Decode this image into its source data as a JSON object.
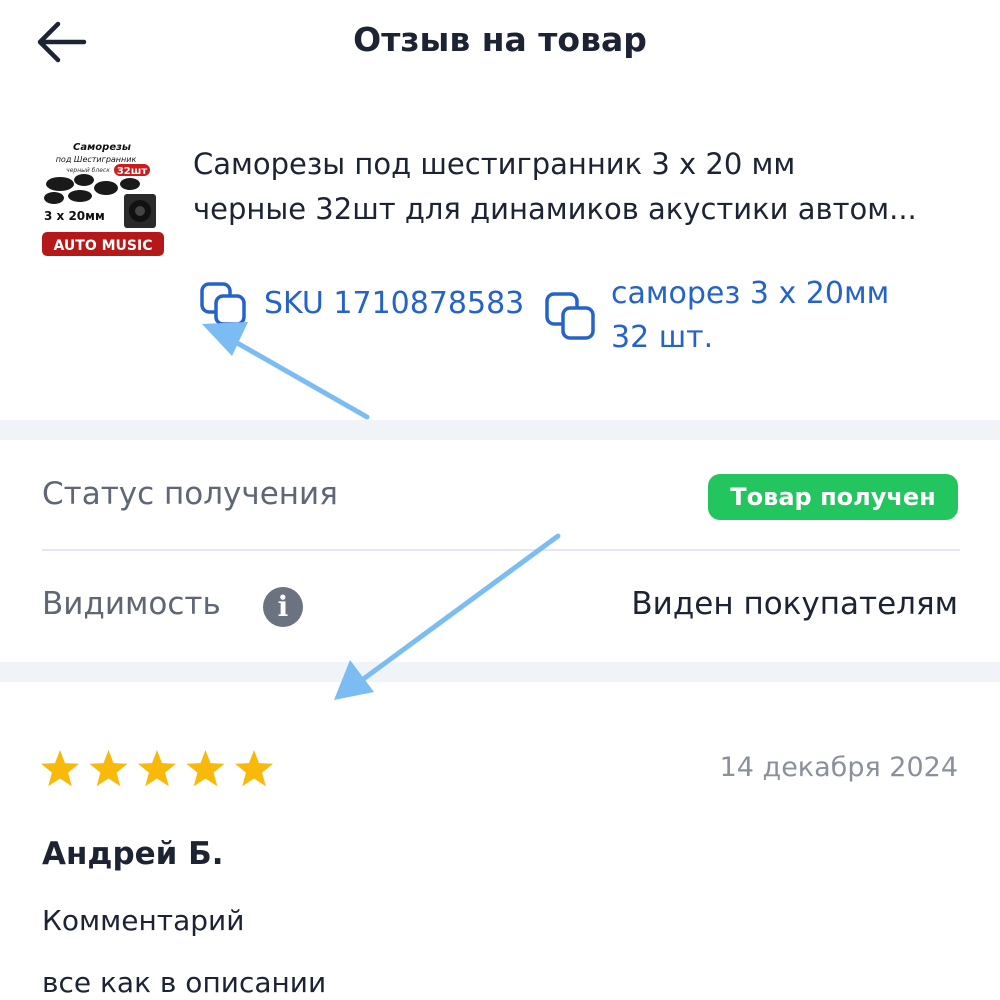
{
  "header": {
    "title": "Отзыв на товар",
    "back_icon": "arrow-left-icon"
  },
  "product": {
    "image": {
      "caption_line1": "Саморезы",
      "caption_line2": "под Шестигранник",
      "caption_line3": "черный блеск",
      "badge": "32шт",
      "size": "3 x 20мм",
      "brand": "AUTO MUSIC"
    },
    "name_line1": "Саморезы под шестигранник 3 х 20 мм",
    "name_line2": "черные 32шт для динамиков акустики автом...",
    "sku_label": "SKU 1710878583",
    "variant_line1": "саморез 3 х 20мм",
    "variant_line2": "32 шт.",
    "copy_icon": "copy-icon",
    "link_color": "#2563c9"
  },
  "status": {
    "label": "Статус получения",
    "badge": "Товар получен",
    "badge_color": "#22c55e"
  },
  "visibility": {
    "label": "Видимость",
    "info_icon": "info-icon",
    "value": "Виден покупателям"
  },
  "review": {
    "rating": 5,
    "max_rating": 5,
    "star_color": "#f9b90b",
    "date": "14 декабря 2024",
    "author": "Андрей Б.",
    "comment_label": "Комментарий",
    "comment": "все как в описании"
  }
}
